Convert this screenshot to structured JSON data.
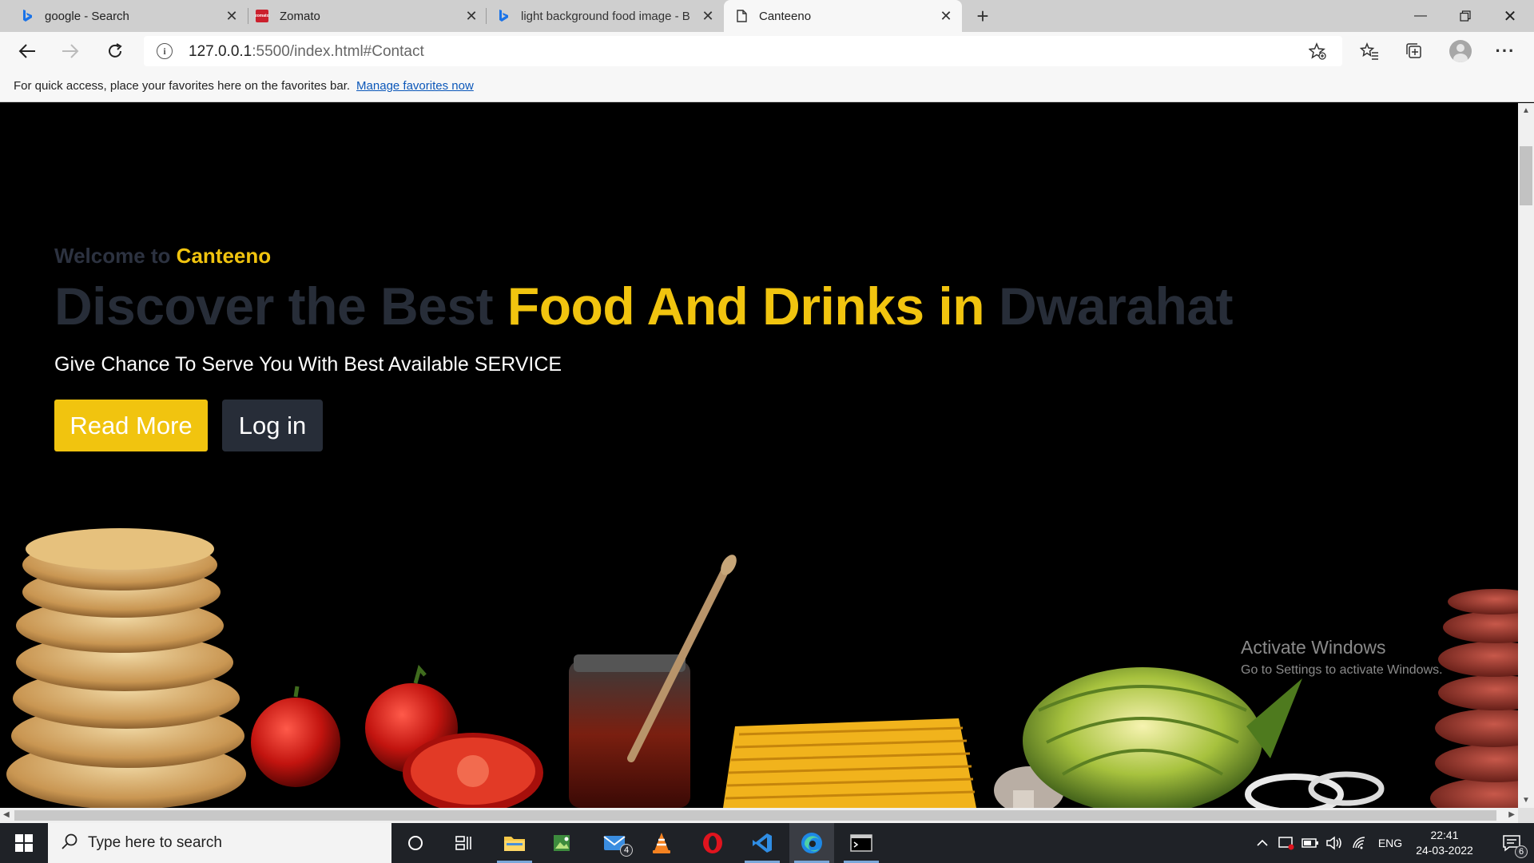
{
  "browser": {
    "tabs": [
      {
        "title": "google - Search",
        "favicon": "bing-icon"
      },
      {
        "title": "Zomato",
        "favicon": "zomato-icon"
      },
      {
        "title": "light background food image - B",
        "favicon": "bing-icon"
      },
      {
        "title": "Canteeno",
        "favicon": "page-icon",
        "active": true
      }
    ],
    "address": {
      "host": "127.0.0.1",
      "rest": ":5500/index.html#Contact"
    },
    "favorites_bar": {
      "text": "For quick access, place your favorites here on the favorites bar.",
      "link": "Manage favorites now"
    }
  },
  "page": {
    "welcome_prefix": "Welcome to",
    "brand": "Canteeno",
    "headline_part1": "Discover the Best",
    "headline_highlight": "Food And Drinks in",
    "headline_part2": "Dwarahat",
    "tagline": "Give Chance To Serve You With Best Available SERVICE",
    "read_more": "Read More",
    "login": "Log in"
  },
  "watermark": {
    "line1": "Activate Windows",
    "line2": "Go to Settings to activate Windows."
  },
  "taskbar": {
    "search_placeholder": "Type here to search",
    "language": "ENG",
    "time": "22:41",
    "date": "24-03-2022",
    "mail_badge": "4",
    "notification_count": "6"
  },
  "colors": {
    "accent": "#f1c40f",
    "dark_button": "#272d38",
    "page_bg": "#000000"
  }
}
